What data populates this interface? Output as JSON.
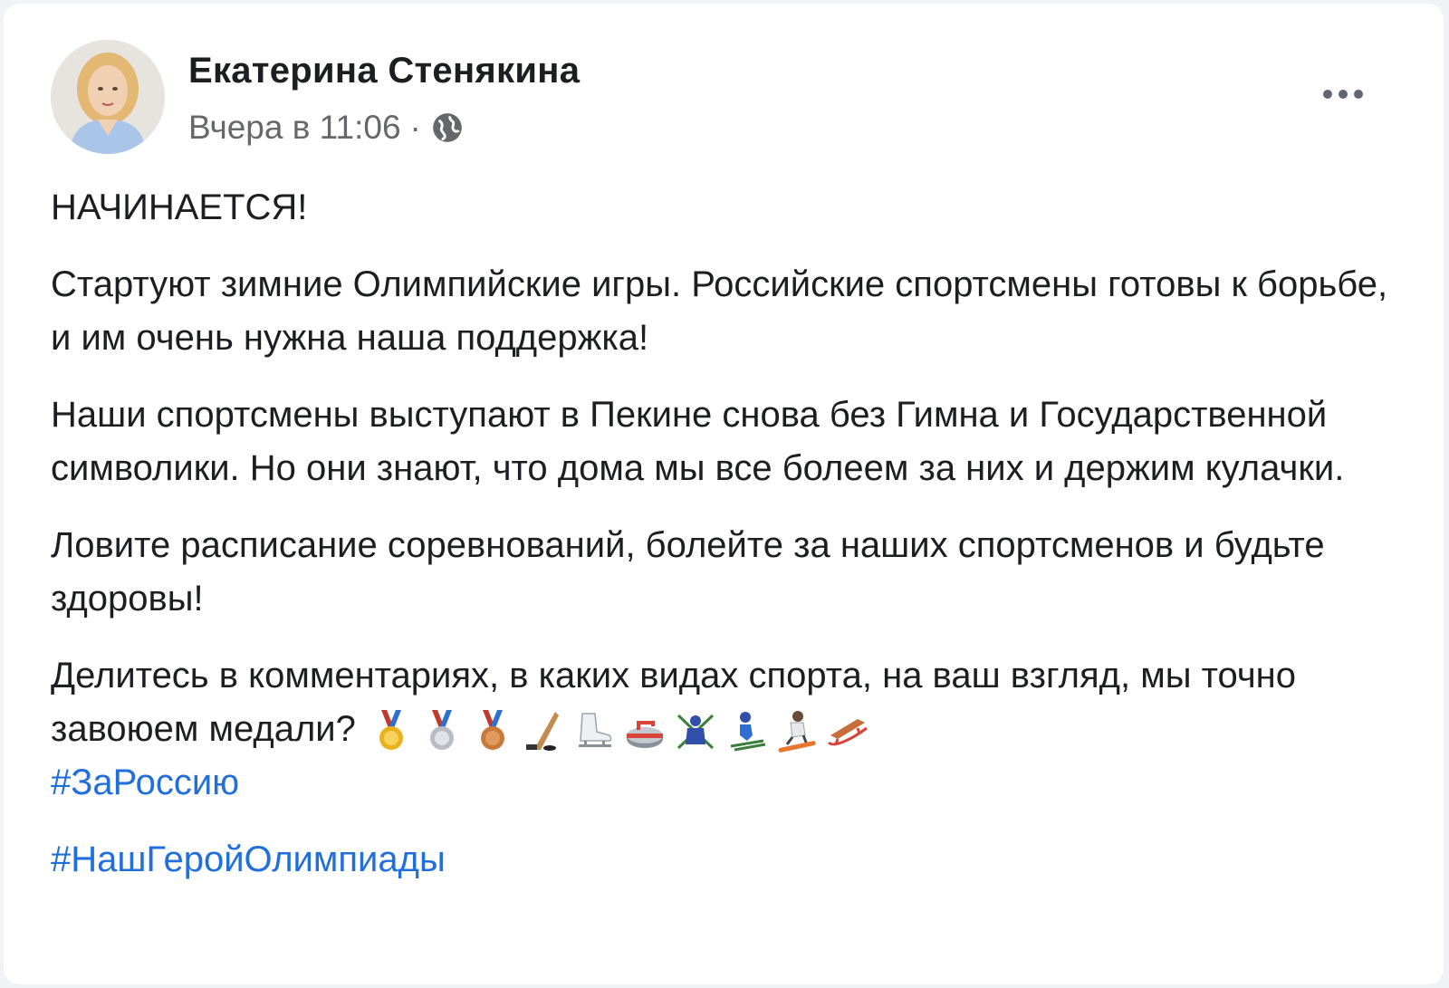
{
  "post": {
    "author_name": "Екатерина Стенякина",
    "timestamp": "Вчера в 11:06",
    "separator": "·",
    "privacy_icon": "globe-icon",
    "more_icon": "more-horizontal-icon",
    "paragraphs": [
      "НАЧИНАЕТСЯ!",
      "Стартуют зимние Олимпийские игры. Российские спортсмены готовы к борьбе, и им очень нужна наша поддержка!",
      "Наши спортсмены выступают в Пекине снова без Гимна и Государственной символики. Но они знают, что дома мы все болеем за них и держим кулачки.",
      "Ловите расписание соревнований, болейте за наших спортсменов и будьте здоровы!"
    ],
    "final_paragraph": "Делитесь в комментариях, в каких видах спорта, на ваш взгляд, мы точно завоюем медали?",
    "emojis": [
      "gold-medal-icon",
      "silver-medal-icon",
      "bronze-medal-icon",
      "hockey-stick-icon",
      "ice-skate-icon",
      "curling-stone-icon",
      "biathlon-icon",
      "skier-icon",
      "snowboarder-icon",
      "sled-icon"
    ],
    "hashtags": [
      "#ЗаРоссию",
      "#НашГеройОлимпиады"
    ]
  },
  "colors": {
    "link": "#216fdb",
    "text": "#1c1e21",
    "secondary": "#65676b",
    "gold": "#e9b21c",
    "silver": "#c5c8cc",
    "bronze": "#c77a3a",
    "ribbon": "#c0392b"
  }
}
